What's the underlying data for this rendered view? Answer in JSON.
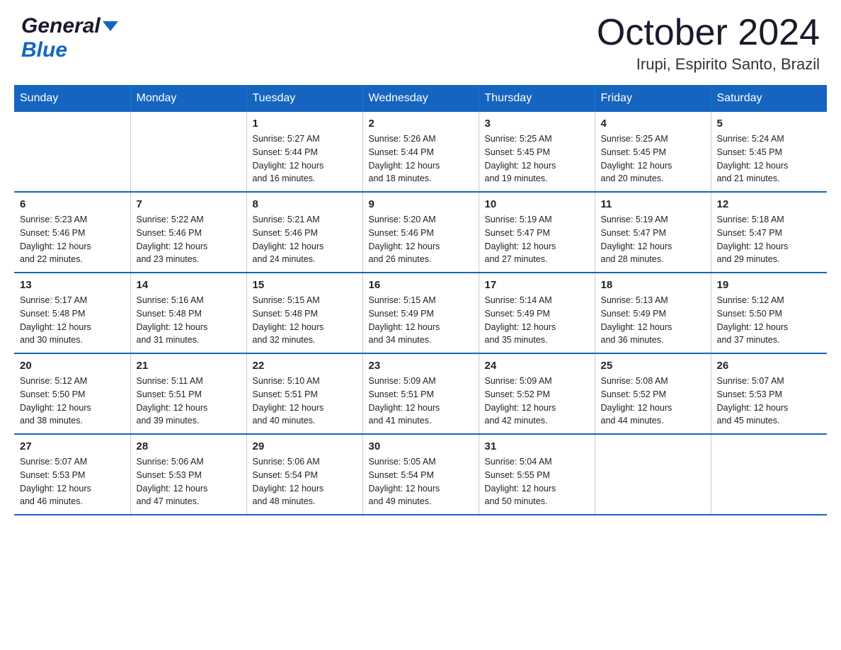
{
  "header": {
    "logo_general": "General",
    "logo_blue": "Blue",
    "month": "October 2024",
    "location": "Irupi, Espirito Santo, Brazil"
  },
  "days_of_week": [
    "Sunday",
    "Monday",
    "Tuesday",
    "Wednesday",
    "Thursday",
    "Friday",
    "Saturday"
  ],
  "weeks": [
    [
      {
        "day": "",
        "info": ""
      },
      {
        "day": "",
        "info": ""
      },
      {
        "day": "1",
        "info": "Sunrise: 5:27 AM\nSunset: 5:44 PM\nDaylight: 12 hours\nand 16 minutes."
      },
      {
        "day": "2",
        "info": "Sunrise: 5:26 AM\nSunset: 5:44 PM\nDaylight: 12 hours\nand 18 minutes."
      },
      {
        "day": "3",
        "info": "Sunrise: 5:25 AM\nSunset: 5:45 PM\nDaylight: 12 hours\nand 19 minutes."
      },
      {
        "day": "4",
        "info": "Sunrise: 5:25 AM\nSunset: 5:45 PM\nDaylight: 12 hours\nand 20 minutes."
      },
      {
        "day": "5",
        "info": "Sunrise: 5:24 AM\nSunset: 5:45 PM\nDaylight: 12 hours\nand 21 minutes."
      }
    ],
    [
      {
        "day": "6",
        "info": "Sunrise: 5:23 AM\nSunset: 5:46 PM\nDaylight: 12 hours\nand 22 minutes."
      },
      {
        "day": "7",
        "info": "Sunrise: 5:22 AM\nSunset: 5:46 PM\nDaylight: 12 hours\nand 23 minutes."
      },
      {
        "day": "8",
        "info": "Sunrise: 5:21 AM\nSunset: 5:46 PM\nDaylight: 12 hours\nand 24 minutes."
      },
      {
        "day": "9",
        "info": "Sunrise: 5:20 AM\nSunset: 5:46 PM\nDaylight: 12 hours\nand 26 minutes."
      },
      {
        "day": "10",
        "info": "Sunrise: 5:19 AM\nSunset: 5:47 PM\nDaylight: 12 hours\nand 27 minutes."
      },
      {
        "day": "11",
        "info": "Sunrise: 5:19 AM\nSunset: 5:47 PM\nDaylight: 12 hours\nand 28 minutes."
      },
      {
        "day": "12",
        "info": "Sunrise: 5:18 AM\nSunset: 5:47 PM\nDaylight: 12 hours\nand 29 minutes."
      }
    ],
    [
      {
        "day": "13",
        "info": "Sunrise: 5:17 AM\nSunset: 5:48 PM\nDaylight: 12 hours\nand 30 minutes."
      },
      {
        "day": "14",
        "info": "Sunrise: 5:16 AM\nSunset: 5:48 PM\nDaylight: 12 hours\nand 31 minutes."
      },
      {
        "day": "15",
        "info": "Sunrise: 5:15 AM\nSunset: 5:48 PM\nDaylight: 12 hours\nand 32 minutes."
      },
      {
        "day": "16",
        "info": "Sunrise: 5:15 AM\nSunset: 5:49 PM\nDaylight: 12 hours\nand 34 minutes."
      },
      {
        "day": "17",
        "info": "Sunrise: 5:14 AM\nSunset: 5:49 PM\nDaylight: 12 hours\nand 35 minutes."
      },
      {
        "day": "18",
        "info": "Sunrise: 5:13 AM\nSunset: 5:49 PM\nDaylight: 12 hours\nand 36 minutes."
      },
      {
        "day": "19",
        "info": "Sunrise: 5:12 AM\nSunset: 5:50 PM\nDaylight: 12 hours\nand 37 minutes."
      }
    ],
    [
      {
        "day": "20",
        "info": "Sunrise: 5:12 AM\nSunset: 5:50 PM\nDaylight: 12 hours\nand 38 minutes."
      },
      {
        "day": "21",
        "info": "Sunrise: 5:11 AM\nSunset: 5:51 PM\nDaylight: 12 hours\nand 39 minutes."
      },
      {
        "day": "22",
        "info": "Sunrise: 5:10 AM\nSunset: 5:51 PM\nDaylight: 12 hours\nand 40 minutes."
      },
      {
        "day": "23",
        "info": "Sunrise: 5:09 AM\nSunset: 5:51 PM\nDaylight: 12 hours\nand 41 minutes."
      },
      {
        "day": "24",
        "info": "Sunrise: 5:09 AM\nSunset: 5:52 PM\nDaylight: 12 hours\nand 42 minutes."
      },
      {
        "day": "25",
        "info": "Sunrise: 5:08 AM\nSunset: 5:52 PM\nDaylight: 12 hours\nand 44 minutes."
      },
      {
        "day": "26",
        "info": "Sunrise: 5:07 AM\nSunset: 5:53 PM\nDaylight: 12 hours\nand 45 minutes."
      }
    ],
    [
      {
        "day": "27",
        "info": "Sunrise: 5:07 AM\nSunset: 5:53 PM\nDaylight: 12 hours\nand 46 minutes."
      },
      {
        "day": "28",
        "info": "Sunrise: 5:06 AM\nSunset: 5:53 PM\nDaylight: 12 hours\nand 47 minutes."
      },
      {
        "day": "29",
        "info": "Sunrise: 5:06 AM\nSunset: 5:54 PM\nDaylight: 12 hours\nand 48 minutes."
      },
      {
        "day": "30",
        "info": "Sunrise: 5:05 AM\nSunset: 5:54 PM\nDaylight: 12 hours\nand 49 minutes."
      },
      {
        "day": "31",
        "info": "Sunrise: 5:04 AM\nSunset: 5:55 PM\nDaylight: 12 hours\nand 50 minutes."
      },
      {
        "day": "",
        "info": ""
      },
      {
        "day": "",
        "info": ""
      }
    ]
  ]
}
